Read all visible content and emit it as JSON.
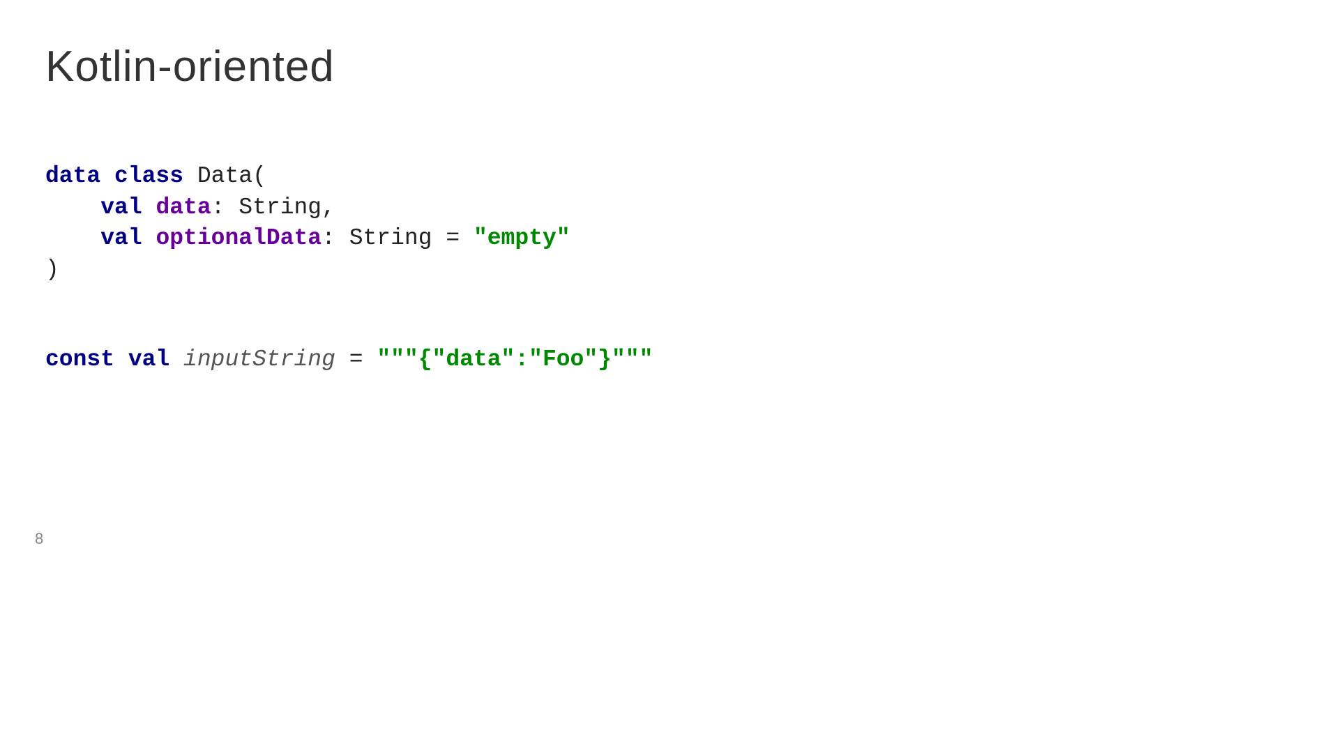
{
  "slide": {
    "title": "Kotlin-oriented",
    "pageNumber": "8",
    "code": {
      "line1": {
        "kw1": "data class",
        "className": " Data("
      },
      "line2": {
        "indent": "    ",
        "kw": "val",
        "prop": " data",
        "rest": ": String,"
      },
      "line3": {
        "indent": "    ",
        "kw": "val",
        "prop": " optionalData",
        "rest": ": String = ",
        "str": "\"empty\""
      },
      "line4": {
        "text": ")"
      },
      "line5": {
        "kw1": "const val",
        "space": " ",
        "varName": "inputString",
        "eq": " = ",
        "str": "\"\"\"{\"data\":\"Foo\"}\"\"\""
      }
    }
  }
}
